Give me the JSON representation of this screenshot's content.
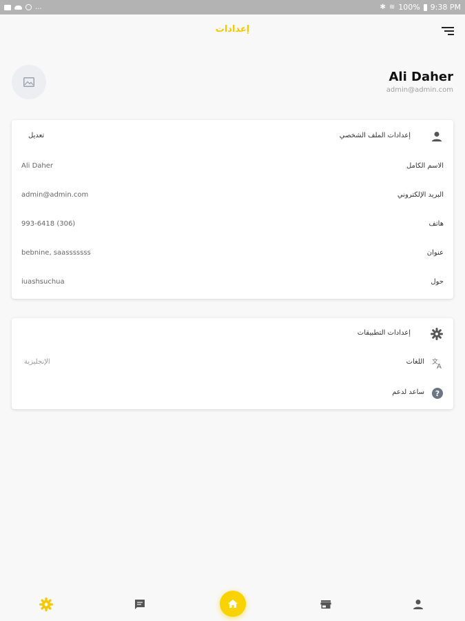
{
  "statusbar": {
    "left_text": "...",
    "battery": "100%",
    "time": "9:38 PM"
  },
  "header": {
    "title": "إعدادات",
    "menu_icon": "sort-menu-icon"
  },
  "profile": {
    "name": "Ali Daher",
    "email": "admin@admin.com"
  },
  "profile_settings": {
    "title": "إعدادات الملف الشخصي",
    "edit_label": "تعديل",
    "rows": [
      {
        "label": "الاسم الكامل",
        "value": "Ali Daher"
      },
      {
        "label": "البريد الإلكتروني",
        "value": "admin@admin.com"
      },
      {
        "label": "هاتف",
        "value": "993-6418 (306)"
      },
      {
        "label": "عنوان",
        "value": "bebnine, saasssssss"
      },
      {
        "label": "حول",
        "value": "iuashsuchua"
      }
    ]
  },
  "app_settings": {
    "title": "إعدادات التطبيقات",
    "language_label": "اللغات",
    "language_value": "الإنجليزية",
    "support_label": "ساعد لدعم"
  },
  "bottom_nav": {
    "items": [
      "settings-icon",
      "chat-icon",
      "home-icon",
      "store-icon",
      "person-icon"
    ],
    "active_color": "#f5c800"
  },
  "colors": {
    "accent": "#f5c800",
    "background": "#f8f8f8"
  }
}
